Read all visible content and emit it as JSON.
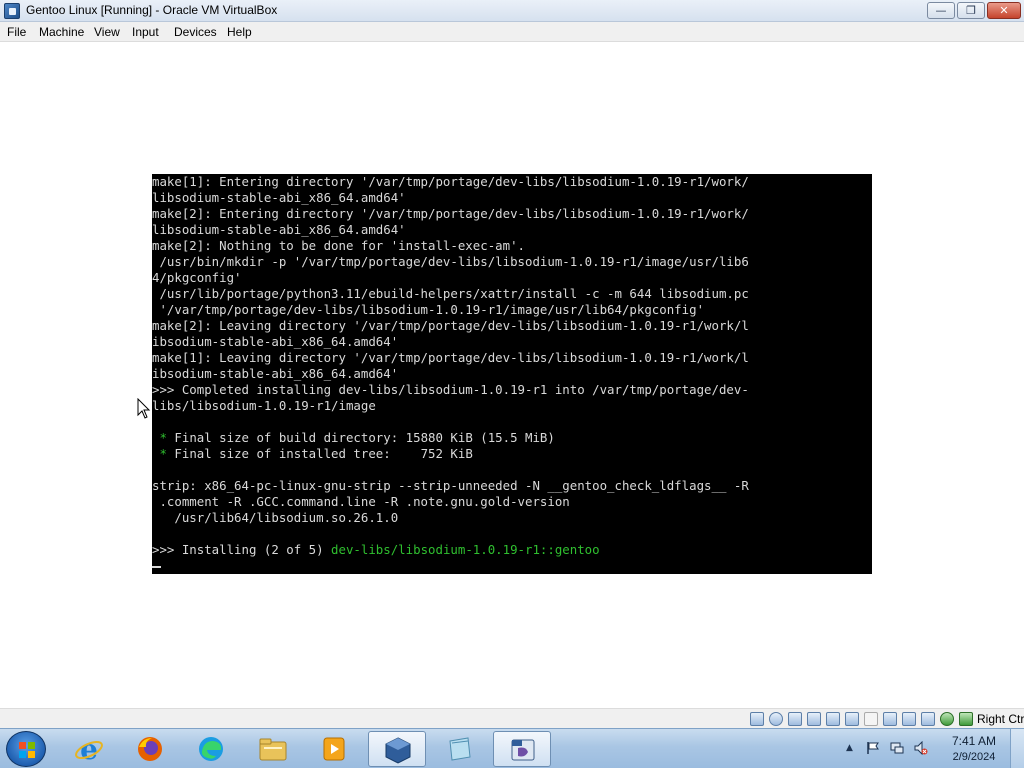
{
  "window": {
    "title": "Gentoo Linux [Running] - Oracle VM VirtualBox",
    "minimize_glyph": "—",
    "maximize_glyph": "❐",
    "close_glyph": "✕"
  },
  "menu": [
    "File",
    "Machine",
    "View",
    "Input",
    "Devices",
    "Help"
  ],
  "console": {
    "lines": [
      "make[1]: Entering directory '/var/tmp/portage/dev-libs/libsodium-1.0.19-r1/work/",
      "libsodium-stable-abi_x86_64.amd64'",
      "make[2]: Entering directory '/var/tmp/portage/dev-libs/libsodium-1.0.19-r1/work/",
      "libsodium-stable-abi_x86_64.amd64'",
      "make[2]: Nothing to be done for 'install-exec-am'.",
      " /usr/bin/mkdir -p '/var/tmp/portage/dev-libs/libsodium-1.0.19-r1/image/usr/lib6",
      "4/pkgconfig'",
      " /usr/lib/portage/python3.11/ebuild-helpers/xattr/install -c -m 644 libsodium.pc",
      " '/var/tmp/portage/dev-libs/libsodium-1.0.19-r1/image/usr/lib64/pkgconfig'",
      "make[2]: Leaving directory '/var/tmp/portage/dev-libs/libsodium-1.0.19-r1/work/l",
      "ibsodium-stable-abi_x86_64.amd64'",
      "make[1]: Leaving directory '/var/tmp/portage/dev-libs/libsodium-1.0.19-r1/work/l",
      "ibsodium-stable-abi_x86_64.amd64'",
      ">>> Completed installing dev-libs/libsodium-1.0.19-r1 into /var/tmp/portage/dev-",
      "libs/libsodium-1.0.19-r1/image",
      "",
      " * Final size of build directory: 15880 KiB (15.5 MiB)",
      " * Final size of installed tree:    752 KiB",
      "",
      "strip: x86_64-pc-linux-gnu-strip --strip-unneeded -N __gentoo_check_ldflags__ -R",
      " .comment -R .GCC.command.line -R .note.gnu.gold-version",
      "   /usr/lib64/libsodium.so.26.1.0",
      "",
      ">>> Installing (2 of 5) dev-libs/libsodium-1.0.19-r1::gentoo"
    ],
    "star": "*",
    "final_build_rest": " Final size of build directory: 15880 KiB (15.5 MiB)",
    "final_tree_rest": " Final size of installed tree:    752 KiB",
    "installing_prefix": ">>> Installing (2 of 5) ",
    "installing_pkg": "dev-libs/libsodium-1.0.19-r1::gentoo",
    "text_color": "#d9d9d9",
    "green_color": "#2fbf2f"
  },
  "statusbar": {
    "host_key": "Right Ctrl",
    "icons": [
      "hard-disk-icon",
      "optical-drive-icon",
      "floppy-icon",
      "audio-icon",
      "network-icon",
      "usb-icon",
      "shared-folders-icon",
      "display-icon",
      "recording-icon",
      "video-capture-icon",
      "cpu-icon",
      "mouse-integration-icon",
      "keyboard-icon"
    ]
  },
  "taskbar": {
    "apps": [
      "internet-explorer-icon",
      "firefox-icon",
      "edge-icon",
      "file-explorer-icon",
      "media-player-icon",
      "virtualbox-icon",
      "notepad-icon",
      "virtualbox-vm-icon"
    ],
    "tray_up_glyph": "▲",
    "clock_time": "7:41 AM",
    "clock_date": "2/9/2024"
  }
}
